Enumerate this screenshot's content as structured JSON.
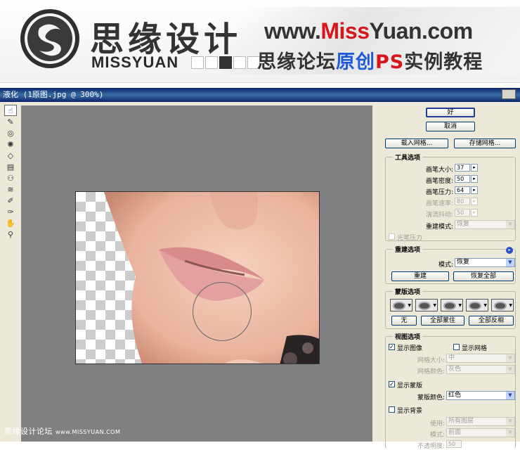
{
  "banner": {
    "brand_cn": "思缘设计",
    "brand_en": "MISSYUAN",
    "url_part1": "www.",
    "url_part2": "Miss",
    "url_part3": "Yuan",
    "url_part4": ".com",
    "slogan_part1": "思缘论坛",
    "slogan_part2": "原创",
    "slogan_part3": "PS",
    "slogan_part4": "实例教程"
  },
  "window": {
    "title": "液化 (1原图.jpg @ 300%)"
  },
  "buttons": {
    "ok": "好",
    "cancel": "取消",
    "load_mesh": "载入网格...",
    "save_mesh": "存储网格..."
  },
  "tool_options": {
    "title": "工具选项",
    "brush_size_label": "画笔大小:",
    "brush_size": "37",
    "brush_density_label": "画笔密度:",
    "brush_density": "50",
    "brush_pressure_label": "画笔压力:",
    "brush_pressure": "64",
    "brush_rate_label": "画笔速率:",
    "brush_rate": "80",
    "turbulent_jitter_label": "湍流抖动:",
    "turbulent_jitter": "50",
    "reconstruct_mode_label": "重建模式:",
    "reconstruct_mode": "恢复",
    "stylus_pressure": "光笔压力"
  },
  "reconstruct_options": {
    "title": "重建选项",
    "mode_label": "模式:",
    "mode": "恢复",
    "reconstruct": "重建",
    "restore_all": "恢复全部"
  },
  "mask_options": {
    "title": "蒙版选项",
    "none": "无",
    "mask_all": "全部蒙住",
    "invert_all": "全部反相"
  },
  "view_options": {
    "title": "视图选项",
    "show_image": "显示图像",
    "show_mesh": "显示网格",
    "mesh_size_label": "网格大小:",
    "mesh_size": "中",
    "mesh_color_label": "网格颜色:",
    "mesh_color": "灰色",
    "show_mask": "显示蒙版",
    "mask_color_label": "蒙版颜色:",
    "mask_color": "红色",
    "show_backdrop": "显示背景",
    "use_label": "使用:",
    "use": "所有图层",
    "mode_label": "模式:",
    "mode": "前面",
    "opacity_label": "不透明度:",
    "opacity": "50"
  },
  "watermark": {
    "cn": "思缘设计论坛",
    "en": "www.MISSYUAN.COM"
  },
  "colors": {
    "title_bar": "#0a246a",
    "canvas_bg": "#808080",
    "panel_bg": "#ece9d8",
    "brand_red": "#d6161b",
    "brand_blue": "#1f5bd6"
  }
}
